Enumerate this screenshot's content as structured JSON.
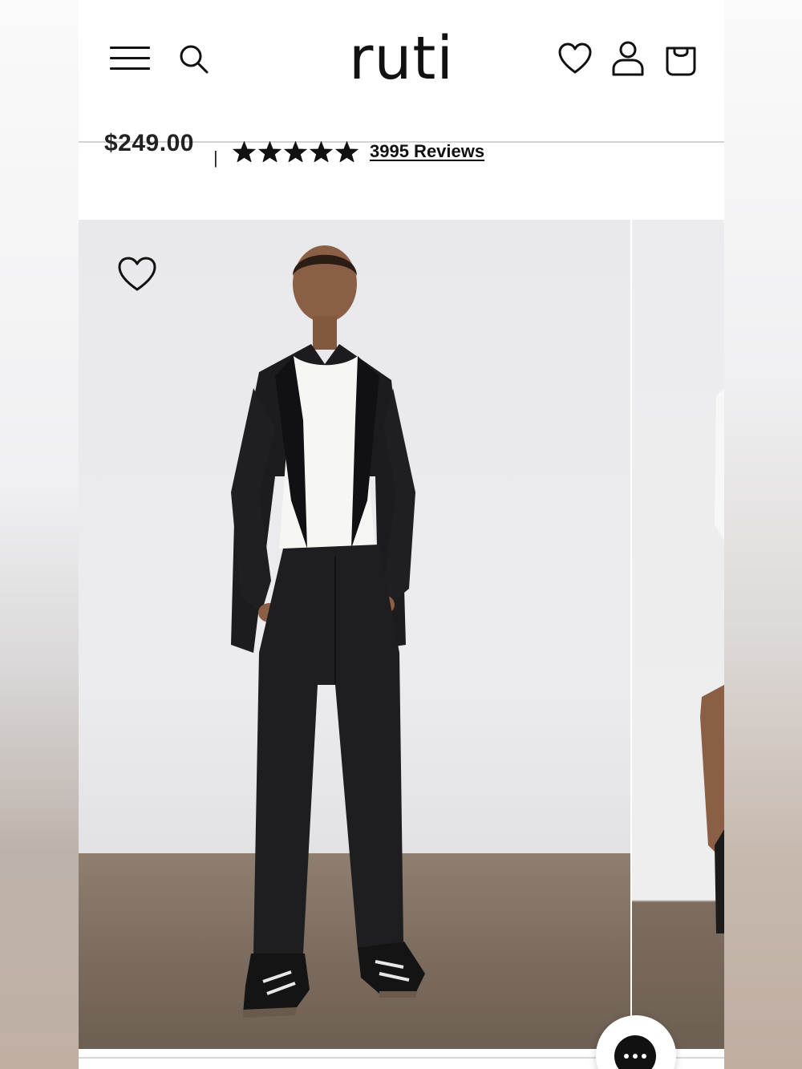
{
  "header": {
    "logo": "ruti",
    "icons": [
      "menu-icon",
      "search-icon",
      "heart-icon",
      "user-icon",
      "shopping-bag-icon"
    ]
  },
  "product": {
    "price": "$249.00",
    "separator": "|",
    "rating": 5,
    "rating_max": 5,
    "reviews_label": "3995 Reviews"
  },
  "gallery": {
    "wishlist_icon": "heart-outline-icon",
    "slides_visible": 2
  },
  "chat": {
    "icon": "more-dots-icon"
  },
  "colors": {
    "text": "#111111",
    "background": "#ffffff",
    "divider": "#d2d2d2"
  }
}
